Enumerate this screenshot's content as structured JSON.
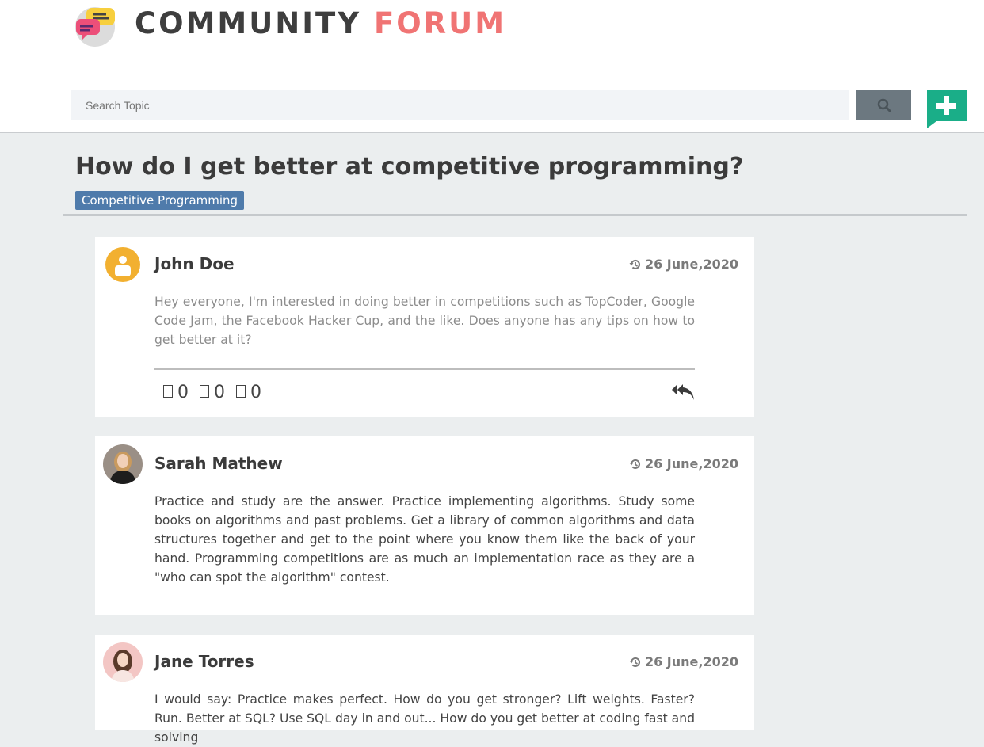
{
  "header": {
    "brand_word1": "COMMUNITY",
    "brand_word2": "FORUM",
    "logo_icon": "speech-bubbles-icon"
  },
  "search": {
    "placeholder": "Search Topic",
    "search_icon": "search-icon",
    "new_topic_icon": "plus-chat-icon"
  },
  "topic": {
    "title": "How do I get better at competitive programming?",
    "tag": "Competitive Programming"
  },
  "posts": [
    {
      "author": "John Doe",
      "date": "26 June,2020",
      "avatar": "default-user-icon",
      "body": "Hey everyone, I'm interested in doing better in competitions such as TopCoder, Google Code Jam, the Facebook Hacker Cup, and the like. Does anyone has any tips on how to get better at it?",
      "reactions": [
        {
          "icon": "like-icon",
          "count": "0"
        },
        {
          "icon": "dislike-icon",
          "count": "0"
        },
        {
          "icon": "comment-icon",
          "count": "0"
        }
      ],
      "reply_icon": "reply-all-icon"
    },
    {
      "author": "Sarah Mathew",
      "date": "26 June,2020",
      "avatar": "user-photo",
      "body": "Practice and study are the answer. Practice implementing algorithms. Study some books on algorithms and past problems. Get a library of common algorithms and data structures together and get to the point where you know them like the back of your hand. Programming competitions are as much an implementation race as they are a \"who can spot the algorithm\" contest."
    },
    {
      "author": "Jane Torres",
      "date": "26 June,2020",
      "avatar": "user-photo",
      "body": "I would say: Practice makes perfect. How do you get stronger? Lift weights. Faster? Run. Better at SQL? Use SQL day in and out... How do you get better at coding fast and solving"
    }
  ],
  "colors": {
    "accent_red": "#f07474",
    "tag_blue": "#4f7bab",
    "add_green": "#1aae88",
    "date_icon": "history-icon"
  }
}
